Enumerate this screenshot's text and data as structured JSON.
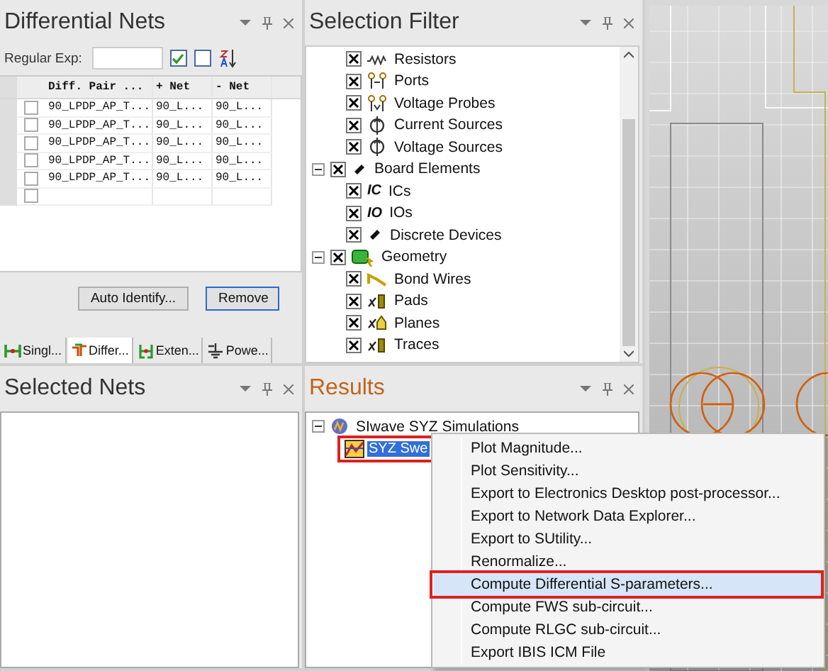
{
  "differential_nets": {
    "title": "Differential Nets",
    "filter_label": "Regular Exp:",
    "check_all": true,
    "uncheck_all": false,
    "columns": [
      "Diff. Pair ...",
      "+ Net",
      "- Net"
    ],
    "rows": [
      {
        "checked": false,
        "cells": [
          "90_LPDP_AP_T...",
          "90_L...",
          "90_L..."
        ]
      },
      {
        "checked": false,
        "cells": [
          "90_LPDP_AP_T...",
          "90_L...",
          "90_L..."
        ]
      },
      {
        "checked": false,
        "cells": [
          "90_LPDP_AP_T...",
          "90_L...",
          "90_L..."
        ]
      },
      {
        "checked": false,
        "cells": [
          "90_LPDP_AP_T...",
          "90_L...",
          "90_L..."
        ]
      },
      {
        "checked": false,
        "cells": [
          "90_LPDP_AP_T...",
          "90_L...",
          "90_L..."
        ]
      },
      {
        "checked": false,
        "cells": []
      }
    ],
    "buttons": [
      {
        "label": "Auto Identify...",
        "focused": false
      },
      {
        "label": "Remove",
        "focused": true
      }
    ],
    "tabs": [
      {
        "label": "Singl...",
        "selected": false
      },
      {
        "label": "Differ...",
        "selected": true
      },
      {
        "label": "Exten...",
        "selected": false
      },
      {
        "label": "Powe...",
        "selected": false
      }
    ]
  },
  "selection_filter": {
    "title": "Selection Filter",
    "tree": [
      {
        "children": [
          {
            "label": "Resistors",
            "checked": true
          },
          {
            "label": "Ports",
            "checked": true
          },
          {
            "label": "Voltage Probes",
            "checked": true
          },
          {
            "label": "Current Sources",
            "checked": true
          },
          {
            "label": "Voltage Sources",
            "checked": true
          }
        ]
      },
      {
        "label": "Board Elements",
        "checked": true,
        "expanded": true,
        "children": [
          {
            "label": "ICs",
            "checked": true,
            "icon_text": "IC"
          },
          {
            "label": "IOs",
            "checked": true,
            "icon_text": "IO"
          },
          {
            "label": "Discrete Devices",
            "checked": true
          }
        ]
      },
      {
        "label": "Geometry",
        "checked": true,
        "expanded": true,
        "children": [
          {
            "label": "Bond Wires",
            "checked": true
          },
          {
            "label": "Pads",
            "checked": true
          },
          {
            "label": "Planes",
            "checked": true
          },
          {
            "label": "Traces",
            "checked": true
          }
        ]
      }
    ]
  },
  "selected_nets": {
    "title": "Selected Nets"
  },
  "results": {
    "title": "Results",
    "tree": [
      {
        "label": "SIwave SYZ Simulations",
        "expanded": true,
        "children": [
          {
            "label": "SYZ Swe",
            "selected": true,
            "highlighted": true
          }
        ]
      }
    ]
  },
  "context_menu": [
    {
      "label": "Plot Magnitude...",
      "selected": false,
      "highlighted": false
    },
    {
      "label": "Plot Sensitivity...",
      "selected": false,
      "highlighted": false
    },
    {
      "label": "Export to Electronics Desktop post-processor...",
      "selected": false,
      "highlighted": false
    },
    {
      "label": "Export to Network Data Explorer...",
      "selected": false,
      "highlighted": false
    },
    {
      "label": "Export to SUtility...",
      "selected": false,
      "highlighted": false
    },
    {
      "label": "Renormalize...",
      "selected": false,
      "highlighted": false
    },
    {
      "label": "Compute Differential S-parameters...",
      "selected": true,
      "highlighted": true
    },
    {
      "label": "Compute FWS sub-circuit...",
      "selected": false,
      "highlighted": false
    },
    {
      "label": "Compute RLGC sub-circuit...",
      "selected": false,
      "highlighted": false
    },
    {
      "label": "Export IBIS ICM File",
      "selected": false,
      "highlighted": false
    }
  ]
}
